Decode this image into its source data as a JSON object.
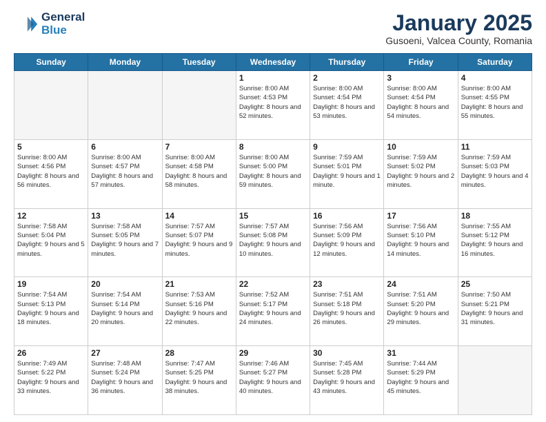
{
  "logo": {
    "line1": "General",
    "line2": "Blue"
  },
  "title": "January 2025",
  "subtitle": "Gusoeni, Valcea County, Romania",
  "days_of_week": [
    "Sunday",
    "Monday",
    "Tuesday",
    "Wednesday",
    "Thursday",
    "Friday",
    "Saturday"
  ],
  "weeks": [
    [
      {
        "day": "",
        "info": "",
        "empty": true
      },
      {
        "day": "",
        "info": "",
        "empty": true
      },
      {
        "day": "",
        "info": "",
        "empty": true
      },
      {
        "day": "1",
        "info": "Sunrise: 8:00 AM\nSunset: 4:53 PM\nDaylight: 8 hours\nand 52 minutes.",
        "empty": false
      },
      {
        "day": "2",
        "info": "Sunrise: 8:00 AM\nSunset: 4:54 PM\nDaylight: 8 hours\nand 53 minutes.",
        "empty": false
      },
      {
        "day": "3",
        "info": "Sunrise: 8:00 AM\nSunset: 4:54 PM\nDaylight: 8 hours\nand 54 minutes.",
        "empty": false
      },
      {
        "day": "4",
        "info": "Sunrise: 8:00 AM\nSunset: 4:55 PM\nDaylight: 8 hours\nand 55 minutes.",
        "empty": false
      }
    ],
    [
      {
        "day": "5",
        "info": "Sunrise: 8:00 AM\nSunset: 4:56 PM\nDaylight: 8 hours\nand 56 minutes.",
        "empty": false
      },
      {
        "day": "6",
        "info": "Sunrise: 8:00 AM\nSunset: 4:57 PM\nDaylight: 8 hours\nand 57 minutes.",
        "empty": false
      },
      {
        "day": "7",
        "info": "Sunrise: 8:00 AM\nSunset: 4:58 PM\nDaylight: 8 hours\nand 58 minutes.",
        "empty": false
      },
      {
        "day": "8",
        "info": "Sunrise: 8:00 AM\nSunset: 5:00 PM\nDaylight: 8 hours\nand 59 minutes.",
        "empty": false
      },
      {
        "day": "9",
        "info": "Sunrise: 7:59 AM\nSunset: 5:01 PM\nDaylight: 9 hours\nand 1 minute.",
        "empty": false
      },
      {
        "day": "10",
        "info": "Sunrise: 7:59 AM\nSunset: 5:02 PM\nDaylight: 9 hours\nand 2 minutes.",
        "empty": false
      },
      {
        "day": "11",
        "info": "Sunrise: 7:59 AM\nSunset: 5:03 PM\nDaylight: 9 hours\nand 4 minutes.",
        "empty": false
      }
    ],
    [
      {
        "day": "12",
        "info": "Sunrise: 7:58 AM\nSunset: 5:04 PM\nDaylight: 9 hours\nand 5 minutes.",
        "empty": false
      },
      {
        "day": "13",
        "info": "Sunrise: 7:58 AM\nSunset: 5:05 PM\nDaylight: 9 hours\nand 7 minutes.",
        "empty": false
      },
      {
        "day": "14",
        "info": "Sunrise: 7:57 AM\nSunset: 5:07 PM\nDaylight: 9 hours\nand 9 minutes.",
        "empty": false
      },
      {
        "day": "15",
        "info": "Sunrise: 7:57 AM\nSunset: 5:08 PM\nDaylight: 9 hours\nand 10 minutes.",
        "empty": false
      },
      {
        "day": "16",
        "info": "Sunrise: 7:56 AM\nSunset: 5:09 PM\nDaylight: 9 hours\nand 12 minutes.",
        "empty": false
      },
      {
        "day": "17",
        "info": "Sunrise: 7:56 AM\nSunset: 5:10 PM\nDaylight: 9 hours\nand 14 minutes.",
        "empty": false
      },
      {
        "day": "18",
        "info": "Sunrise: 7:55 AM\nSunset: 5:12 PM\nDaylight: 9 hours\nand 16 minutes.",
        "empty": false
      }
    ],
    [
      {
        "day": "19",
        "info": "Sunrise: 7:54 AM\nSunset: 5:13 PM\nDaylight: 9 hours\nand 18 minutes.",
        "empty": false
      },
      {
        "day": "20",
        "info": "Sunrise: 7:54 AM\nSunset: 5:14 PM\nDaylight: 9 hours\nand 20 minutes.",
        "empty": false
      },
      {
        "day": "21",
        "info": "Sunrise: 7:53 AM\nSunset: 5:16 PM\nDaylight: 9 hours\nand 22 minutes.",
        "empty": false
      },
      {
        "day": "22",
        "info": "Sunrise: 7:52 AM\nSunset: 5:17 PM\nDaylight: 9 hours\nand 24 minutes.",
        "empty": false
      },
      {
        "day": "23",
        "info": "Sunrise: 7:51 AM\nSunset: 5:18 PM\nDaylight: 9 hours\nand 26 minutes.",
        "empty": false
      },
      {
        "day": "24",
        "info": "Sunrise: 7:51 AM\nSunset: 5:20 PM\nDaylight: 9 hours\nand 29 minutes.",
        "empty": false
      },
      {
        "day": "25",
        "info": "Sunrise: 7:50 AM\nSunset: 5:21 PM\nDaylight: 9 hours\nand 31 minutes.",
        "empty": false
      }
    ],
    [
      {
        "day": "26",
        "info": "Sunrise: 7:49 AM\nSunset: 5:22 PM\nDaylight: 9 hours\nand 33 minutes.",
        "empty": false
      },
      {
        "day": "27",
        "info": "Sunrise: 7:48 AM\nSunset: 5:24 PM\nDaylight: 9 hours\nand 36 minutes.",
        "empty": false
      },
      {
        "day": "28",
        "info": "Sunrise: 7:47 AM\nSunset: 5:25 PM\nDaylight: 9 hours\nand 38 minutes.",
        "empty": false
      },
      {
        "day": "29",
        "info": "Sunrise: 7:46 AM\nSunset: 5:27 PM\nDaylight: 9 hours\nand 40 minutes.",
        "empty": false
      },
      {
        "day": "30",
        "info": "Sunrise: 7:45 AM\nSunset: 5:28 PM\nDaylight: 9 hours\nand 43 minutes.",
        "empty": false
      },
      {
        "day": "31",
        "info": "Sunrise: 7:44 AM\nSunset: 5:29 PM\nDaylight: 9 hours\nand 45 minutes.",
        "empty": false
      },
      {
        "day": "",
        "info": "",
        "empty": true
      }
    ]
  ]
}
